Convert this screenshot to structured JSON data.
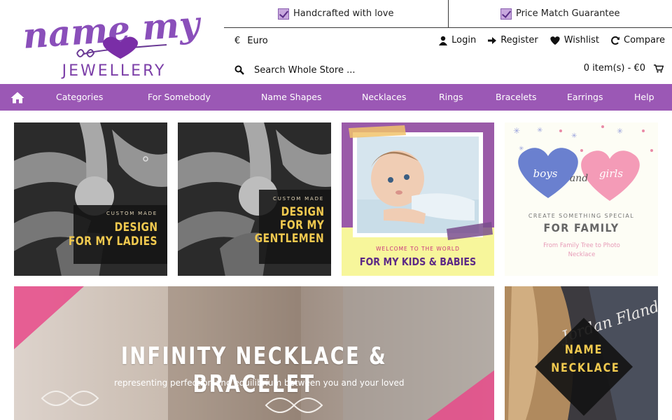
{
  "logo": {
    "line1": "name my",
    "line2": "JEWELLERY"
  },
  "usps": [
    {
      "label": "Handcrafted with love"
    },
    {
      "label": "Price Match Guarantee"
    }
  ],
  "currency": {
    "symbol": "€",
    "label": "Euro"
  },
  "account": {
    "login": "Login",
    "register": "Register",
    "wishlist": "Wishlist",
    "compare": "Compare"
  },
  "search": {
    "placeholder": "Search Whole Store ..."
  },
  "cart": {
    "summary": "0 item(s) - €0"
  },
  "nav": {
    "items": [
      "Categories",
      "For Somebody",
      "Name Shapes",
      "Necklaces",
      "Rings",
      "Bracelets",
      "Earrings",
      "Help"
    ]
  },
  "tiles": {
    "ladies": {
      "kicker": "CUSTOM MADE",
      "line1": "DESIGN",
      "line2": "FOR MY LADIES"
    },
    "gents": {
      "kicker": "CUSTOM MADE",
      "line1": "DESIGN",
      "line2": "FOR MY",
      "line3": "GENTLEMEN"
    },
    "kids": {
      "kicker": "WELCOME TO THE WORLD",
      "title": "FOR MY KIDS & BABIES"
    },
    "family": {
      "word1": "boys",
      "word2": "and",
      "word3": "girls",
      "kicker": "CREATE SOMETHING SPECIAL",
      "title": "FOR FAMILY",
      "desc": "From Family Tree to Photo Necklace"
    },
    "infinity": {
      "title": "INFINITY NECKLACE & BRACELET",
      "subtitle": "representing perfection and equilibrium between you and your loved"
    },
    "name": {
      "title_line1": "NAME",
      "title_line2": "NECKLACE",
      "script": "Jordan Flanders"
    }
  },
  "colors": {
    "brand_purple": "#9b58b5",
    "logo_purple": "#7c3fa8",
    "gold": "#f0c94f",
    "pink": "#e84a8a"
  }
}
